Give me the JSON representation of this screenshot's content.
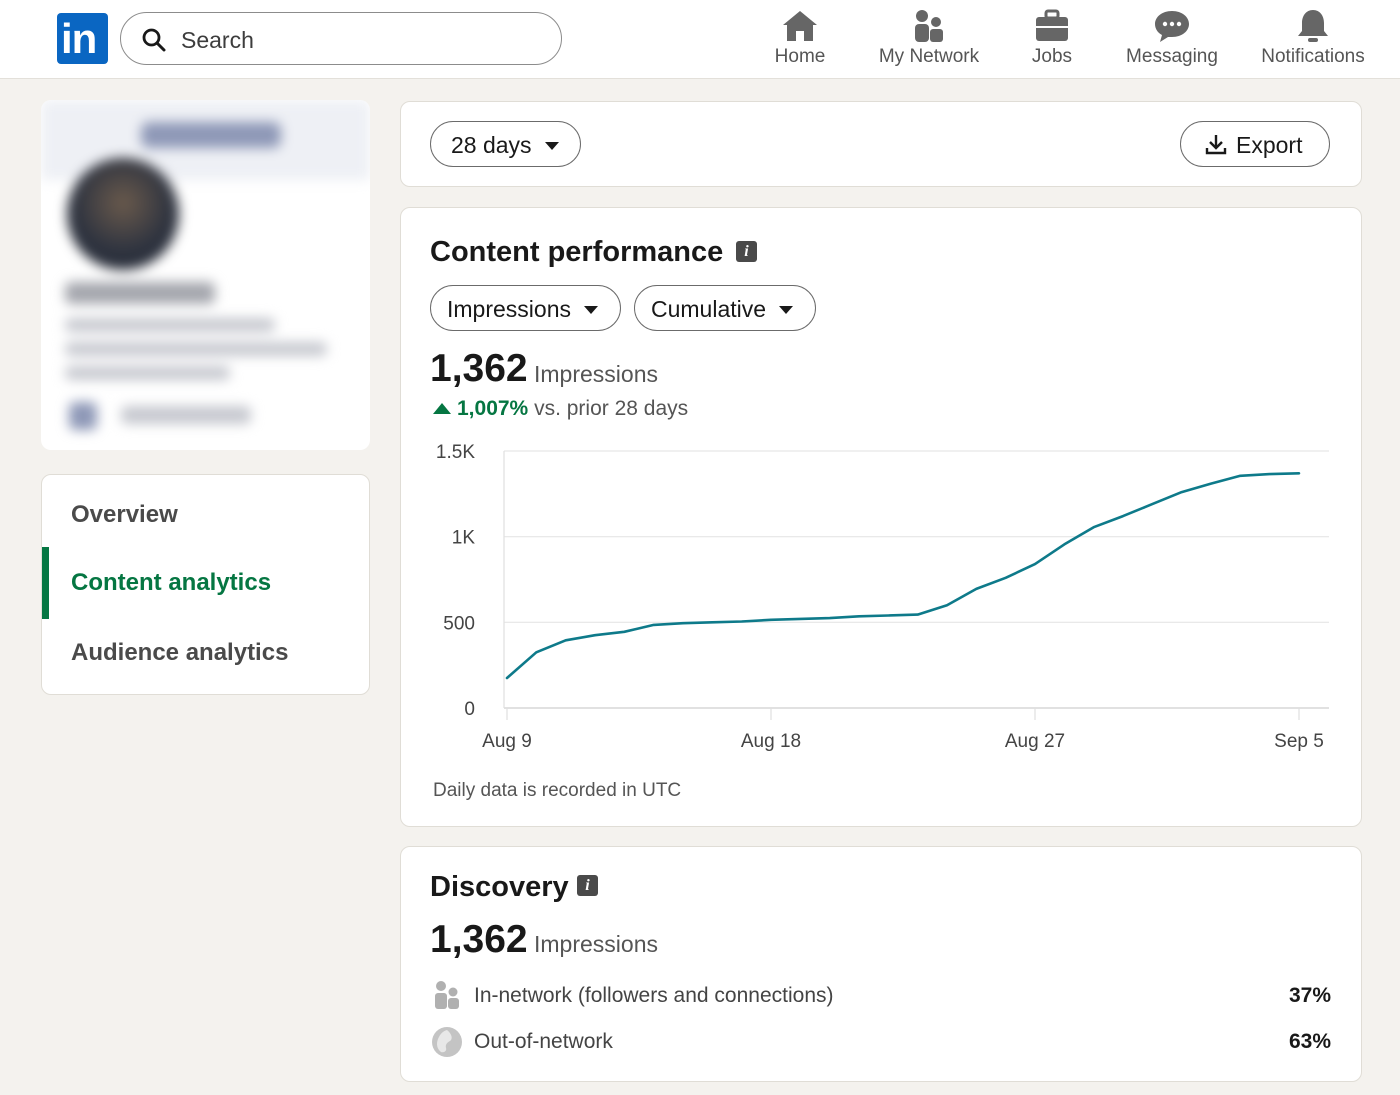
{
  "header": {
    "logo_text": "in",
    "search_placeholder": "Search",
    "nav": [
      {
        "label": "Home",
        "icon": "home-icon"
      },
      {
        "label": "My Network",
        "icon": "network-icon"
      },
      {
        "label": "Jobs",
        "icon": "briefcase-icon"
      },
      {
        "label": "Messaging",
        "icon": "chat-icon"
      },
      {
        "label": "Notifications",
        "icon": "bell-icon"
      }
    ]
  },
  "sidebar": {
    "items": [
      {
        "label": "Overview",
        "active": false
      },
      {
        "label": "Content analytics",
        "active": true
      },
      {
        "label": "Audience analytics",
        "active": false
      }
    ]
  },
  "toolbar": {
    "range_label": "28 days",
    "export_label": "Export"
  },
  "performance": {
    "title": "Content performance",
    "metric_dropdown": "Impressions",
    "mode_dropdown": "Cumulative",
    "total": "1,362",
    "total_label": "Impressions",
    "change": "1,007%",
    "change_suffix": "vs. prior 28 days",
    "footnote": "Daily data is recorded in UTC"
  },
  "chart_data": {
    "type": "line",
    "title": "",
    "xlabel": "",
    "ylabel": "",
    "ylim": [
      0,
      1500
    ],
    "y_ticks": [
      0,
      500,
      1000,
      1500
    ],
    "y_tick_labels": [
      "0",
      "500",
      "1K",
      "1.5K"
    ],
    "x_tick_labels": [
      "Aug 9",
      "Aug 18",
      "Aug 27",
      "Sep 5"
    ],
    "x": [
      "Aug 9",
      "Aug 10",
      "Aug 11",
      "Aug 12",
      "Aug 13",
      "Aug 14",
      "Aug 15",
      "Aug 16",
      "Aug 17",
      "Aug 18",
      "Aug 19",
      "Aug 20",
      "Aug 21",
      "Aug 22",
      "Aug 23",
      "Aug 24",
      "Aug 25",
      "Aug 26",
      "Aug 27",
      "Aug 28",
      "Aug 29",
      "Aug 30",
      "Aug 31",
      "Sep 1",
      "Sep 2",
      "Sep 3",
      "Sep 4",
      "Sep 5"
    ],
    "series": [
      {
        "values": [
          175,
          325,
          395,
          425,
          445,
          485,
          495,
          500,
          505,
          515,
          520,
          525,
          535,
          540,
          545,
          600,
          695,
          760,
          840,
          955,
          1055,
          1120,
          1190,
          1260,
          1310,
          1355,
          1365,
          1370
        ],
        "color": "#0e7a8a"
      }
    ],
    "grid": true,
    "legend": "none"
  },
  "discovery": {
    "title": "Discovery",
    "total": "1,362",
    "total_label": "Impressions",
    "rows": [
      {
        "label": "In-network (followers and connections)",
        "value": "37%",
        "icon": "people-icon"
      },
      {
        "label": "Out-of-network",
        "value": "63%",
        "icon": "globe-icon"
      }
    ]
  },
  "colors": {
    "brand": "#0a66c2",
    "accent_green": "#057642",
    "line": "#0e7a8a"
  }
}
